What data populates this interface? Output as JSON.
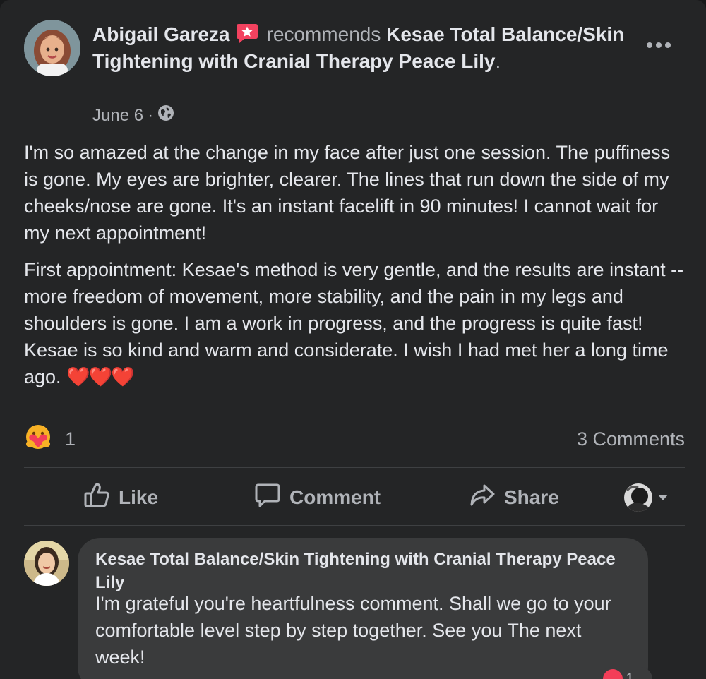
{
  "post": {
    "author": "Abigail Gareza",
    "verb": "recommends",
    "page_name": "Kesae Total Balance/Skin Tightening with Cranial Therapy Peace Lily",
    "period": ".",
    "date": "June 6",
    "separator": "·",
    "audience_icon": "globe-icon",
    "paragraphs": [
      "I'm so amazed at the change in my face after just one session. The puffiness is gone. My eyes are brighter, clearer. The lines that run down the side of my cheeks/nose are gone. It's an instant facelift in 90 minutes! I cannot wait for my next appointment!",
      "First appointment: Kesae's method is very gentle, and the results are instant -- more freedom of movement, more stability, and the pain in my legs and shoulders is gone. I am a work in progress, and the progress is quite fast! Kesae is so kind and warm and considerate. I wish I had met her a long time ago."
    ],
    "hearts": "❤️❤️❤️"
  },
  "reactions": {
    "icon": "care-reaction-icon",
    "count": "1",
    "comments_label": "3 Comments"
  },
  "actions": {
    "like": "Like",
    "comment": "Comment",
    "share": "Share"
  },
  "comment": {
    "author": "Kesae Total Balance/Skin Tightening with Cranial Therapy Peace Lily",
    "text": "I'm grateful you're heartfulness comment. Shall we go to your comfortable level step by step together. See you The next week!",
    "reaction_count": "1"
  },
  "colors": {
    "card_bg": "#242526",
    "text_primary": "#e4e6eb",
    "text_secondary": "#b0b3b8",
    "recommend_badge": "#f3425f",
    "comment_bubble": "#3a3b3c"
  }
}
